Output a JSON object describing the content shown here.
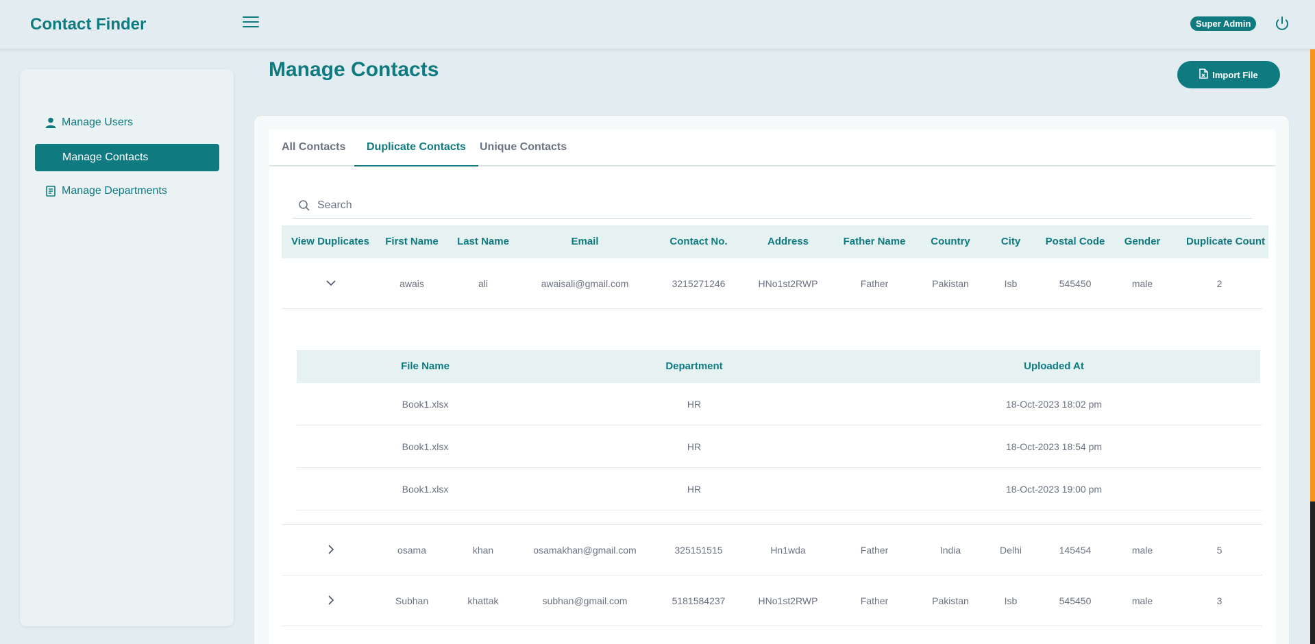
{
  "app": {
    "brand": "Contact Finder",
    "role_badge": "Super Admin"
  },
  "icons": {
    "menu": "hamburger-icon",
    "power": "power-icon",
    "user": "user-icon",
    "departments": "book-icon",
    "file": "file-icon",
    "search": "search-icon",
    "expand": "chevron-down-icon",
    "collapse": "chevron-right-icon"
  },
  "colors": {
    "accent": "#0f7b80",
    "background": "#e3ecf0",
    "scroll_accent": "#f7941d"
  },
  "sidebar": {
    "items": [
      {
        "label": "Manage Users",
        "active": false
      },
      {
        "label": "Manage Contacts",
        "active": true
      },
      {
        "label": "Manage Departments",
        "active": false
      }
    ]
  },
  "page": {
    "title": "Manage Contacts",
    "import_label": "Import File"
  },
  "tabs": [
    {
      "label": "All Contacts",
      "active": false
    },
    {
      "label": "Duplicate Contacts",
      "active": true
    },
    {
      "label": "Unique Contacts",
      "active": false
    }
  ],
  "search": {
    "placeholder": "Search"
  },
  "table": {
    "columns": [
      "View Duplicates",
      "First Name",
      "Last Name",
      "Email",
      "Contact No.",
      "Address",
      "Father Name",
      "Country",
      "City",
      "Postal Code",
      "Gender",
      "Duplicate Count"
    ],
    "rows": [
      {
        "expanded": true,
        "cells": [
          "awais",
          "ali",
          "awaisali@gmail.com",
          "3215271246",
          "HNo1st2RWP",
          "Father",
          "Pakistan",
          "Isb",
          "545450",
          "male",
          "2"
        ]
      },
      {
        "expanded": false,
        "cells": [
          "osama",
          "khan",
          "osamakhan@gmail.com",
          "325151515",
          "Hn1wda",
          "Father",
          "India",
          "Delhi",
          "145454",
          "male",
          "5"
        ]
      },
      {
        "expanded": false,
        "cells": [
          "Subhan",
          "khattak",
          "subhan@gmail.com",
          "5181584237",
          "HNo1st2RWP",
          "Father",
          "Pakistan",
          "Isb",
          "545450",
          "male",
          "3"
        ]
      }
    ]
  },
  "subtable": {
    "columns": [
      "File Name",
      "Department",
      "Uploaded At"
    ],
    "rows": [
      [
        "Book1.xlsx",
        "HR",
        "18-Oct-2023 18:02 pm"
      ],
      [
        "Book1.xlsx",
        "HR",
        "18-Oct-2023 18:54 pm"
      ],
      [
        "Book1.xlsx",
        "HR",
        "18-Oct-2023 19:00 pm"
      ]
    ]
  }
}
